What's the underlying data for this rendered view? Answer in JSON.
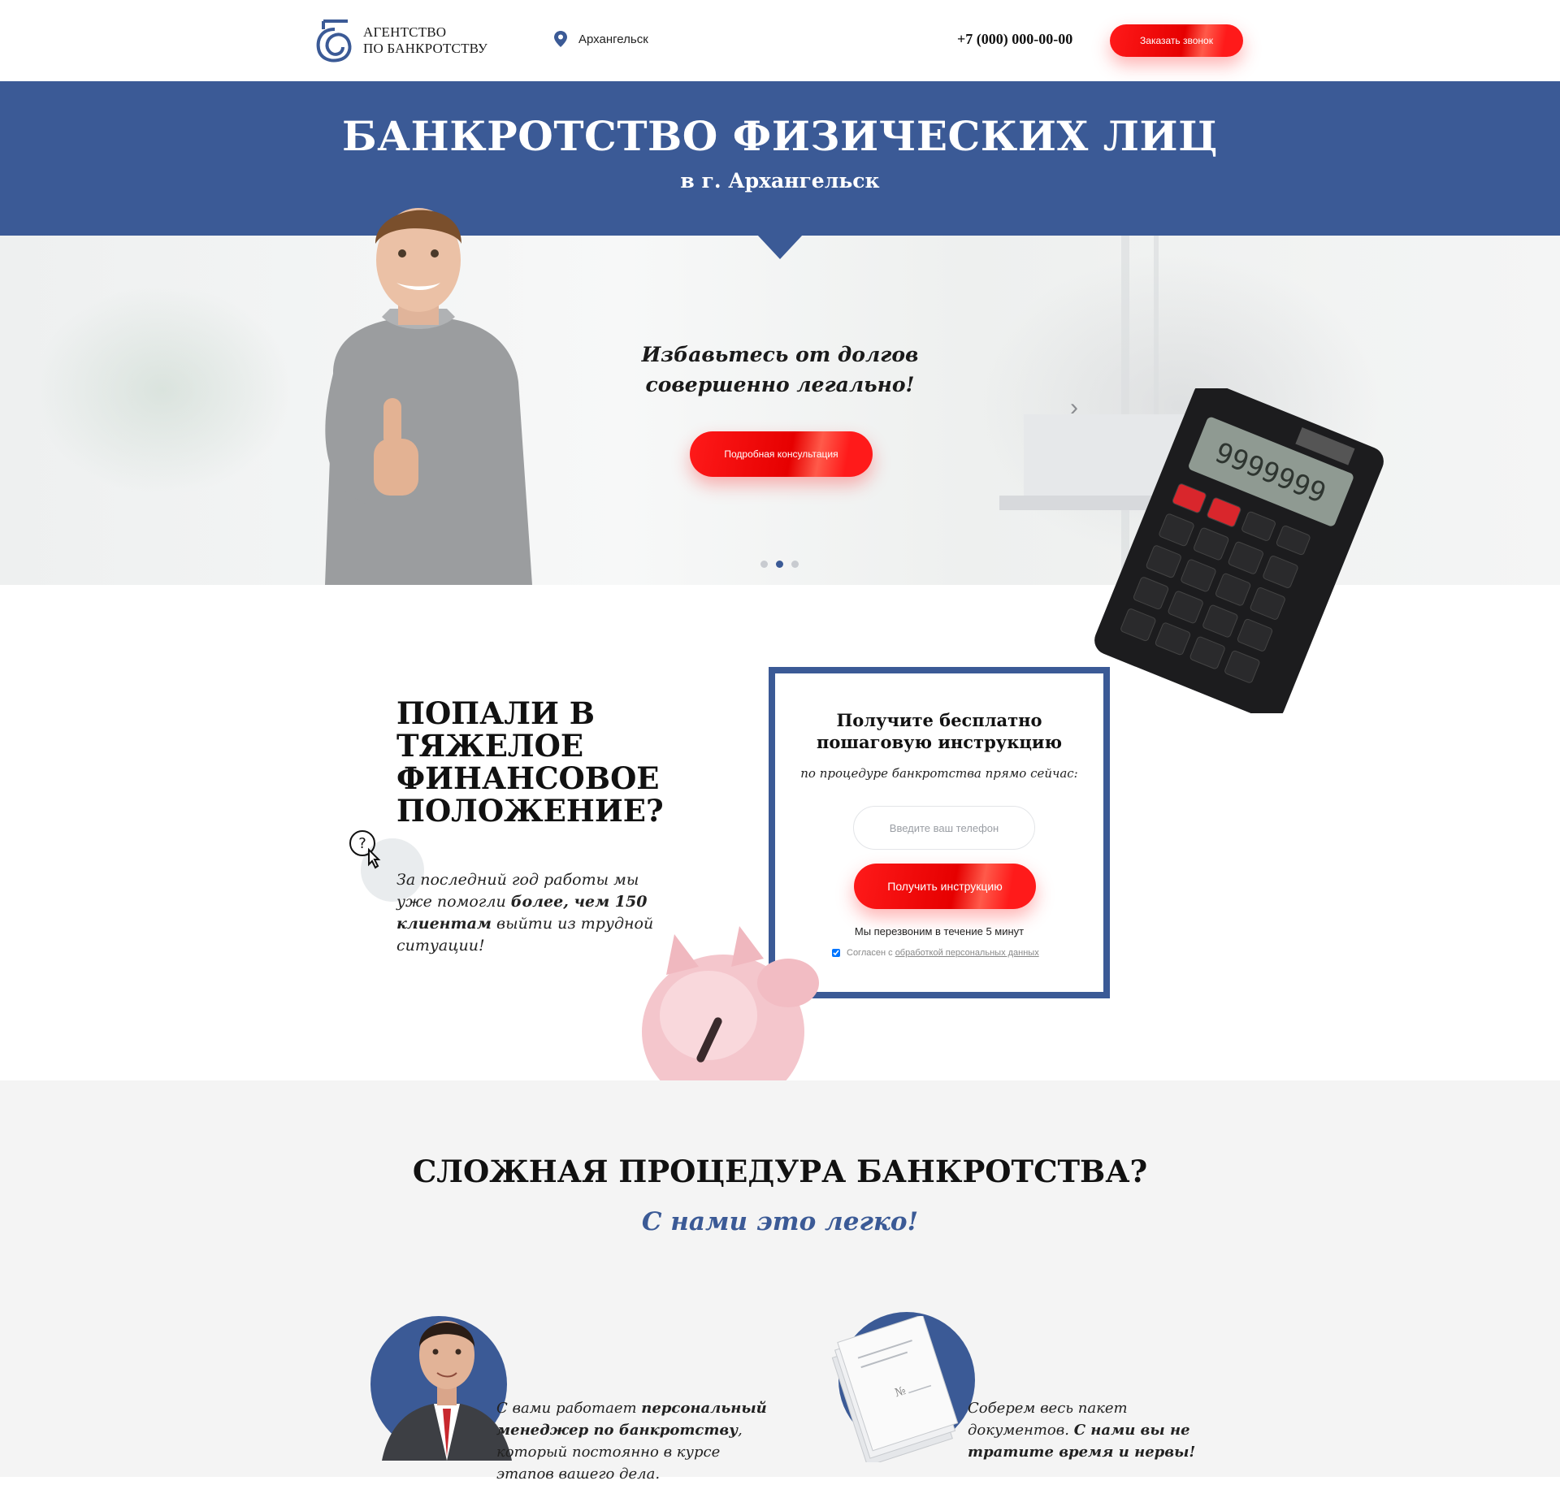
{
  "header": {
    "logo_line1": "АГЕНТСТВО",
    "logo_line2": "ПО БАНКРОТСТВУ",
    "city": "Архангельск",
    "phone": "+7 (000) 000-00-00",
    "call_button": "Заказать звонок"
  },
  "banner": {
    "title": "БАНКРОТСТВО ФИЗИЧЕСКИХ ЛИЦ",
    "subtitle": "в г. Архангельск"
  },
  "hero": {
    "headline_line1": "Избавьтесь от долгов",
    "headline_line2": "совершенно легально!",
    "button": "Подробная консультация",
    "slides_total": 3,
    "active_slide": 2,
    "calculator_display": "9999999"
  },
  "problem": {
    "title_line1": "ПОПАЛИ В ТЯЖЕЛОЕ",
    "title_line2": "ФИНАНСОВОЕ",
    "title_line3": "ПОЛОЖЕНИЕ?",
    "text_part1": "За последний год работы мы уже помогли ",
    "text_bold": "более, чем 150 клиентам",
    "text_part2": " выйти из трудной ситуации!"
  },
  "form": {
    "title_line1": "Получите бесплатно",
    "title_line2": "пошаговую инструкцию",
    "subtitle": "по процедуре банкротства прямо сейчас:",
    "phone_placeholder": "Введите ваш телефон",
    "submit": "Получить инструкцию",
    "note": "Мы перезвоним в течение 5 минут",
    "agree_text": "Согласен с ",
    "agree_link": "обработкой персональных данных"
  },
  "procedure": {
    "title": "СЛОЖНАЯ ПРОЦЕДУРА БАНКРОТСТВА?",
    "subtitle": "С нами это легко!"
  },
  "features": [
    {
      "text_part1": "С вами работает ",
      "text_bold": "персональный менеджер по банкротству",
      "text_part2": ", который постоянно в курсе этапов вашего дела."
    },
    {
      "text_part1": "Соберем весь пакет документов. ",
      "text_bold": "С нами вы не тратите время и нервы!",
      "text_part2": ""
    }
  ],
  "colors": {
    "brand_blue": "#3b5a96",
    "accent_red": "#ff1a1a"
  }
}
